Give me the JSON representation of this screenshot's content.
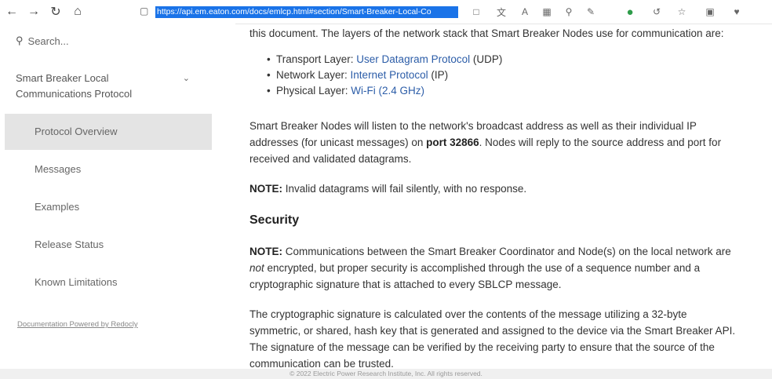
{
  "browser": {
    "url": "https://api.em.eaton.com/docs/emlcp.html#section/Smart-Breaker-Local-Co",
    "icons": [
      "back-icon",
      "forward-icon",
      "refresh-icon",
      "home-icon",
      "lock-icon",
      "reader-icon",
      "translate-icon",
      "read-aloud-icon",
      "screenshot-icon",
      "zoom-icon",
      "extensions-icon",
      "grammarly-icon",
      "sync-icon",
      "favorites-icon",
      "collections-icon",
      "heart-icon"
    ]
  },
  "sidebar": {
    "search_placeholder": "Search...",
    "group_label_line1": "Smart Breaker Local",
    "group_label_line2": "Communications Protocol",
    "items": [
      {
        "label": "Protocol Overview",
        "active": true
      },
      {
        "label": "Messages",
        "active": false
      },
      {
        "label": "Examples",
        "active": false
      },
      {
        "label": "Release Status",
        "active": false
      },
      {
        "label": "Known Limitations",
        "active": false
      }
    ],
    "powered_by": "Documentation Powered by Redocly"
  },
  "content": {
    "intro": "this document. The layers of the network stack that Smart Breaker Nodes use for communication are:",
    "bullets": [
      {
        "prefix": "Transport Layer: ",
        "link": "User Datagram Protocol",
        "suffix": " (UDP)"
      },
      {
        "prefix": "Network Layer: ",
        "link": "Internet Protocol",
        "suffix": " (IP)"
      },
      {
        "prefix": "Physical Layer: ",
        "link": "Wi-Fi",
        "suffix": " (2.4 GHz)"
      }
    ],
    "para1_a": "Smart Breaker Nodes will listen to the network's broadcast address as well as their individual IP",
    "para1_b": "addresses (for unicast messages) on ",
    "para1_port": "port 32866",
    "para1_c": ". Nodes will reply to the source address and port for",
    "para1_d": "received and validated datagrams.",
    "note1_label": "NOTE:",
    "note1_text": " Invalid datagrams will fail silently, with no response.",
    "security_heading": "Security",
    "note2_label": "NOTE:",
    "note2_a": " Communications between the Smart Breaker Coordinator and Node(s) on the local network are",
    "note2_not": "not",
    "note2_b": " encrypted, but proper security is accomplished through the use of a sequence number and a",
    "note2_c": "cryptographic signature that is attached to every SBLCP message.",
    "para3_a": "The cryptographic signature is calculated over the contents of the message utilizing a 32-byte",
    "para3_b": "symmetric, or shared, hash key that is generated and assigned to the device via the Smart Breaker API.",
    "para3_c": "The signature of the message can be verified by the receiving party to ensure that the source of the",
    "para3_d": "communication can be trusted."
  },
  "footer": "© 2022 Electric Power Research Institute, Inc. All rights reserved."
}
